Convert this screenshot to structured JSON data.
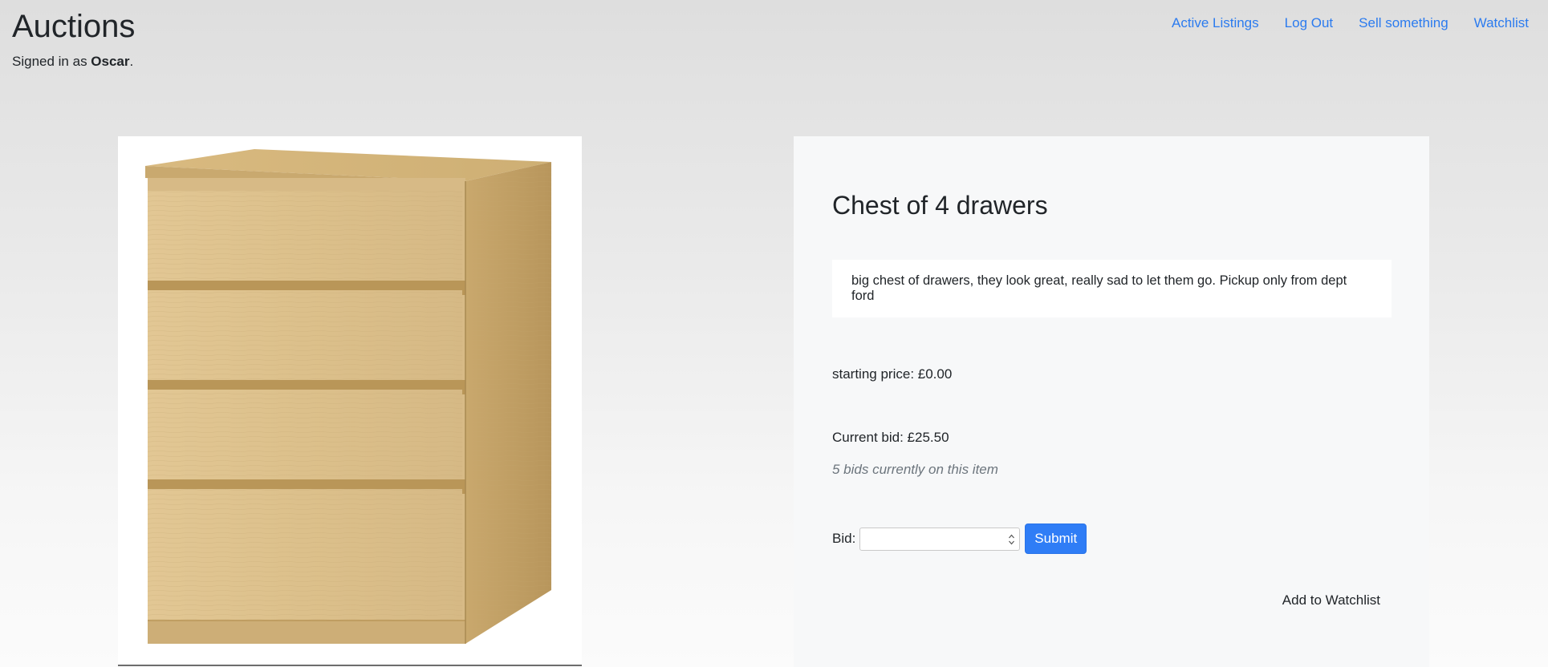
{
  "site": {
    "title": "Auctions",
    "signed_in_prefix": "Signed in as ",
    "username": "Oscar",
    "signed_in_suffix": "."
  },
  "nav": {
    "items": [
      {
        "label": "Active Listings"
      },
      {
        "label": "Log Out"
      },
      {
        "label": "Sell something"
      },
      {
        "label": "Watchlist"
      }
    ],
    "link_color": "#2b7bef"
  },
  "listing": {
    "image_subject": "chest-of-drawers-image",
    "title": "Chest of 4 drawers",
    "description": "big chest of drawers, they look great, really sad to let them go. Pickup only from dept ford",
    "starting_price": "starting price: £0.00",
    "current_bid": "Current bid: £25.50",
    "bids_count": "5 bids currently on this item"
  },
  "bid_form": {
    "label": "Bid:",
    "input_value": "",
    "submit_label": "Submit",
    "submit_color": "#2f7df6"
  },
  "watchlist_action": {
    "label": "Add to Watchlist"
  }
}
